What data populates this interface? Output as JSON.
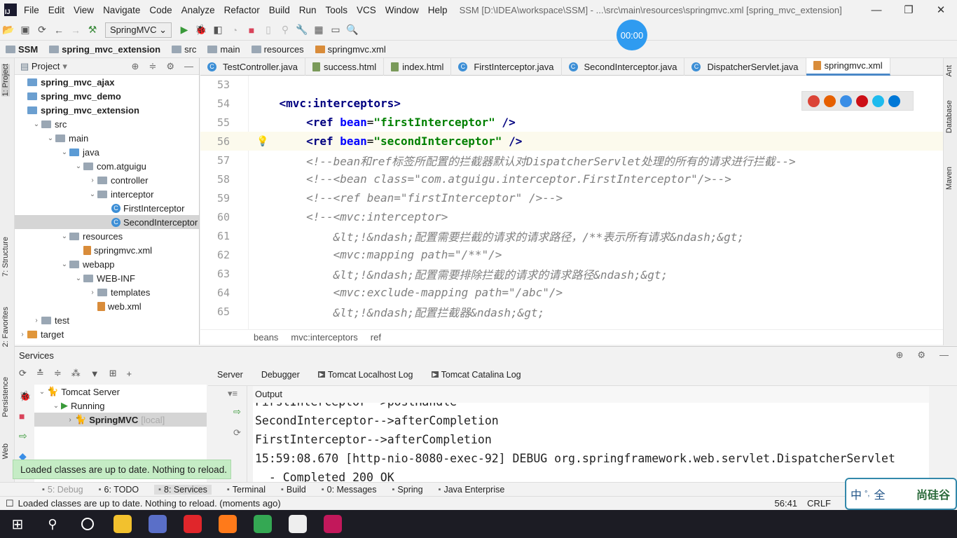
{
  "menubar": {
    "items": [
      "File",
      "Edit",
      "View",
      "Navigate",
      "Code",
      "Analyze",
      "Refactor",
      "Build",
      "Run",
      "Tools",
      "VCS",
      "Window",
      "Help"
    ],
    "title": "SSM [D:\\IDEA\\workspace\\SSM] - ...\\src\\main\\resources\\springmvc.xml [spring_mvc_extension]"
  },
  "toolbar": {
    "run_config": "SpringMVC"
  },
  "timer": "00:00",
  "navbar": [
    "SSM",
    "spring_mvc_extension",
    "src",
    "main",
    "resources",
    "springmvc.xml"
  ],
  "left_strip": [
    "1: Project",
    "7: Structure",
    "2: Favorites",
    "Persistence",
    "Web"
  ],
  "right_strip": [
    "Ant",
    "Database",
    "Maven"
  ],
  "project": {
    "title": "Project",
    "tree": [
      {
        "label": "spring_mvc_ajax",
        "level": 0,
        "arrow": "",
        "icon": "module",
        "bold": true
      },
      {
        "label": "spring_mvc_demo",
        "level": 0,
        "arrow": "",
        "icon": "module",
        "bold": true
      },
      {
        "label": "spring_mvc_extension",
        "level": 0,
        "arrow": "",
        "icon": "module",
        "bold": true
      },
      {
        "label": "src",
        "level": 1,
        "arrow": "v",
        "icon": "folder"
      },
      {
        "label": "main",
        "level": 2,
        "arrow": "v",
        "icon": "folder"
      },
      {
        "label": "java",
        "level": 3,
        "arrow": "v",
        "icon": "folder-blue"
      },
      {
        "label": "com.atguigu",
        "level": 4,
        "arrow": "v",
        "icon": "package"
      },
      {
        "label": "controller",
        "level": 5,
        "arrow": ">",
        "icon": "package"
      },
      {
        "label": "interceptor",
        "level": 5,
        "arrow": "v",
        "icon": "package"
      },
      {
        "label": "FirstInterceptor",
        "level": 6,
        "arrow": "",
        "icon": "class"
      },
      {
        "label": "SecondInterceptor",
        "level": 6,
        "arrow": "",
        "icon": "class",
        "selected": true
      },
      {
        "label": "resources",
        "level": 3,
        "arrow": "v",
        "icon": "folder"
      },
      {
        "label": "springmvc.xml",
        "level": 4,
        "arrow": "",
        "icon": "xml"
      },
      {
        "label": "webapp",
        "level": 3,
        "arrow": "v",
        "icon": "folder"
      },
      {
        "label": "WEB-INF",
        "level": 4,
        "arrow": "v",
        "icon": "folder"
      },
      {
        "label": "templates",
        "level": 5,
        "arrow": ">",
        "icon": "folder"
      },
      {
        "label": "web.xml",
        "level": 5,
        "arrow": "",
        "icon": "xml"
      },
      {
        "label": "test",
        "level": 1,
        "arrow": ">",
        "icon": "folder"
      },
      {
        "label": "target",
        "level": 0,
        "arrow": ">",
        "icon": "folder-orange"
      }
    ]
  },
  "tabs": [
    {
      "label": "TestController.java",
      "icon": "class"
    },
    {
      "label": "success.html",
      "icon": "html"
    },
    {
      "label": "index.html",
      "icon": "html"
    },
    {
      "label": "FirstInterceptor.java",
      "icon": "class"
    },
    {
      "label": "SecondInterceptor.java",
      "icon": "class"
    },
    {
      "label": "DispatcherServlet.java",
      "icon": "class"
    },
    {
      "label": "springmvc.xml",
      "icon": "xml",
      "active": true
    }
  ],
  "editor": {
    "current_line": "56",
    "lines": [
      {
        "n": "53",
        "segs": []
      },
      {
        "n": "54",
        "segs": [
          {
            "t": "    "
          },
          {
            "t": "<mvc:interceptors>",
            "c": "tg"
          }
        ]
      },
      {
        "n": "55",
        "segs": [
          {
            "t": "        "
          },
          {
            "t": "<ref ",
            "c": "tg"
          },
          {
            "t": "bean",
            "c": "at"
          },
          {
            "t": "=",
            "c": "pl"
          },
          {
            "t": "\"firstInterceptor\"",
            "c": "vl"
          },
          {
            "t": " />",
            "c": "tg"
          }
        ]
      },
      {
        "n": "56",
        "segs": [
          {
            "t": "        "
          },
          {
            "t": "<ref ",
            "c": "tg"
          },
          {
            "t": "bean",
            "c": "at"
          },
          {
            "t": "=",
            "c": "pl"
          },
          {
            "t": "\"secondInterceptor\"",
            "c": "vl"
          },
          {
            "t": " />",
            "c": "tg"
          }
        ]
      },
      {
        "n": "57",
        "segs": [
          {
            "t": "        "
          },
          {
            "t": "<!--bean和ref标签所配置的拦截器默认对DispatcherServlet处理的所有的请求进行拦截-->",
            "c": "cm"
          }
        ]
      },
      {
        "n": "58",
        "segs": [
          {
            "t": "        "
          },
          {
            "t": "<!--<bean class=\"com.atguigu.interceptor.FirstInterceptor\"/>-->",
            "c": "cm"
          }
        ]
      },
      {
        "n": "59",
        "segs": [
          {
            "t": "        "
          },
          {
            "t": "<!--<ref bean=\"firstInterceptor\" />-->",
            "c": "cm"
          }
        ]
      },
      {
        "n": "60",
        "segs": [
          {
            "t": "        "
          },
          {
            "t": "<!--<mvc:interceptor>",
            "c": "cm"
          }
        ]
      },
      {
        "n": "61",
        "segs": [
          {
            "t": "            "
          },
          {
            "t": "&lt;!&ndash;配置需要拦截的请求的请求路径，/**表示所有请求&ndash;&gt;",
            "c": "cm"
          }
        ]
      },
      {
        "n": "62",
        "segs": [
          {
            "t": "            "
          },
          {
            "t": "<mvc:mapping path=\"/**\"/>",
            "c": "cm"
          }
        ]
      },
      {
        "n": "63",
        "segs": [
          {
            "t": "            "
          },
          {
            "t": "&lt;!&ndash;配置需要排除拦截的请求的请求路径&ndash;&gt;",
            "c": "cm"
          }
        ]
      },
      {
        "n": "64",
        "segs": [
          {
            "t": "            "
          },
          {
            "t": "<mvc:exclude-mapping path=\"/abc\"/>",
            "c": "cm"
          }
        ]
      },
      {
        "n": "65",
        "segs": [
          {
            "t": "            "
          },
          {
            "t": "&lt;!&ndash;配置拦截器&ndash;&gt;",
            "c": "cm"
          }
        ]
      }
    ],
    "breadcrumb": [
      "beans",
      "mvc:interceptors",
      "ref"
    ]
  },
  "browsers": [
    {
      "name": "chrome",
      "color": "#db4437"
    },
    {
      "name": "firefox",
      "color": "#e66000"
    },
    {
      "name": "safari",
      "color": "#3a8ee6"
    },
    {
      "name": "opera",
      "color": "#cc0f16"
    },
    {
      "name": "ie",
      "color": "#1ebbee"
    },
    {
      "name": "edge",
      "color": "#0078d7"
    }
  ],
  "services": {
    "title": "Services",
    "tree": [
      {
        "label": "Tomcat Server",
        "level": 0,
        "arrow": "v"
      },
      {
        "label": "Running",
        "level": 1,
        "arrow": "v"
      },
      {
        "label": "SpringMVC",
        "suffix": "[local]",
        "level": 2,
        "arrow": ">",
        "selected": true
      }
    ],
    "tabs": [
      "Server",
      "Debugger",
      "Tomcat Localhost Log",
      "Tomcat Catalina Log"
    ],
    "output_label": "Output",
    "output": [
      "FirstInterceptor-->postHandle",
      "SecondInterceptor-->afterCompletion",
      "FirstInterceptor-->afterCompletion",
      "15:59:08.670 [http-nio-8080-exec-92] DEBUG org.springframework.web.servlet.DispatcherServlet",
      "  - Completed 200 OK"
    ]
  },
  "notice": "Loaded classes are up to date. Nothing to reload.",
  "tool_tabs": [
    "5: Debug",
    "6: TODO",
    "8: Services",
    "Terminal",
    "Build",
    "0: Messages",
    "Spring",
    "Java Enterprise"
  ],
  "status": {
    "message": "Loaded classes are up to date. Nothing to reload. (moments ago)",
    "position": "56:41",
    "line_sep": "CRLF"
  },
  "ime": {
    "chars": [
      "中",
      "°,",
      "全"
    ],
    "brand": "尚硅谷"
  },
  "taskbar": [
    {
      "name": "start"
    },
    {
      "name": "search"
    },
    {
      "name": "cortana"
    },
    {
      "name": "app-yellow",
      "color": "#f2c12e"
    },
    {
      "name": "app-blue",
      "color": "#5a6fc8"
    },
    {
      "name": "youdao",
      "color": "#e0262b"
    },
    {
      "name": "firefox",
      "color": "#ff7a1a"
    },
    {
      "name": "chrome",
      "color": "#34a853"
    },
    {
      "name": "typora",
      "color": "#eee"
    },
    {
      "name": "intellij",
      "color": "#c2185b"
    }
  ]
}
